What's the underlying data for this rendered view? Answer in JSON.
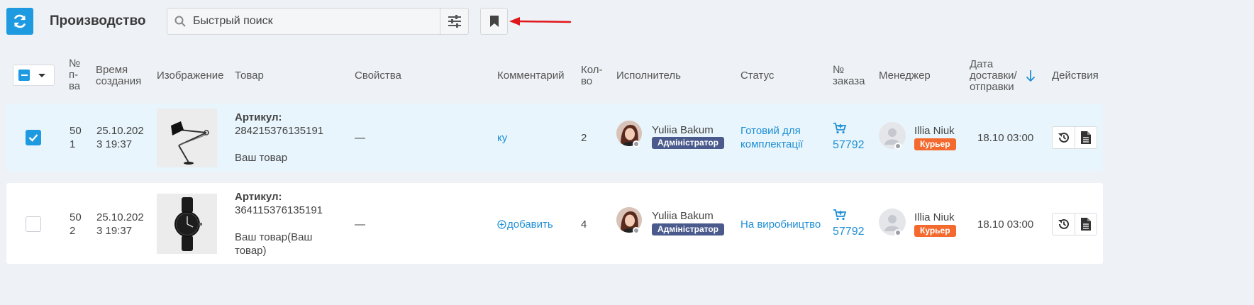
{
  "toolbar": {
    "title": "Производство",
    "search_placeholder": "Быстрый поиск"
  },
  "colors": {
    "accent": "#1e9ae0",
    "link": "#1e8fd5",
    "selected_row": "#e8f5fc",
    "admin_badge": "#4a5a8c",
    "courier_badge": "#f46a2e",
    "annotation_arrow": "#e0161b"
  },
  "table": {
    "headers": {
      "num": [
        "№",
        "п-",
        "ва"
      ],
      "created": [
        "Время",
        "создания"
      ],
      "image": "Изображение",
      "product": "Товар",
      "properties": "Свойства",
      "comment": "Комментарий",
      "qty": [
        "Кол-",
        "во"
      ],
      "executor": "Исполнитель",
      "status": "Статус",
      "order": [
        "№",
        "заказа"
      ],
      "manager": "Менеджер",
      "delivery": [
        "Дата",
        "доставки/",
        "отправки"
      ],
      "actions": "Действия"
    },
    "rows": [
      {
        "checked": true,
        "num": [
          "50",
          "1"
        ],
        "created": [
          "25.10.202",
          "3 19:37"
        ],
        "image_icon": "desk-lamp-image",
        "sku_label": "Артикул:",
        "sku": "284215376135191",
        "product_name": [
          "Ваш товар"
        ],
        "properties": "—",
        "comment": "ку",
        "qty": "2",
        "executor_name": "Yuliia Bakum",
        "executor_role": "Адміністратор",
        "status": [
          "Готовий для",
          "комплектації"
        ],
        "order_number": "57792",
        "manager_name": "Illia Niuk",
        "manager_role": "Курьер",
        "delivery": "18.10 03:00"
      },
      {
        "checked": false,
        "num": [
          "50",
          "2"
        ],
        "created": [
          "25.10.202",
          "3 19:37"
        ],
        "image_icon": "wristwatch-image",
        "sku_label": "Артикул:",
        "sku": "364115376135191",
        "product_name": [
          "Ваш товар(Ваш",
          "товар)"
        ],
        "properties": "—",
        "comment": "добавить",
        "qty": "4",
        "executor_name": "Yuliia Bakum",
        "executor_role": "Адміністратор",
        "status": [
          "На виробництво"
        ],
        "order_number": "57792",
        "manager_name": "Illia Niuk",
        "manager_role": "Курьер",
        "delivery": "18.10 03:00"
      }
    ]
  }
}
